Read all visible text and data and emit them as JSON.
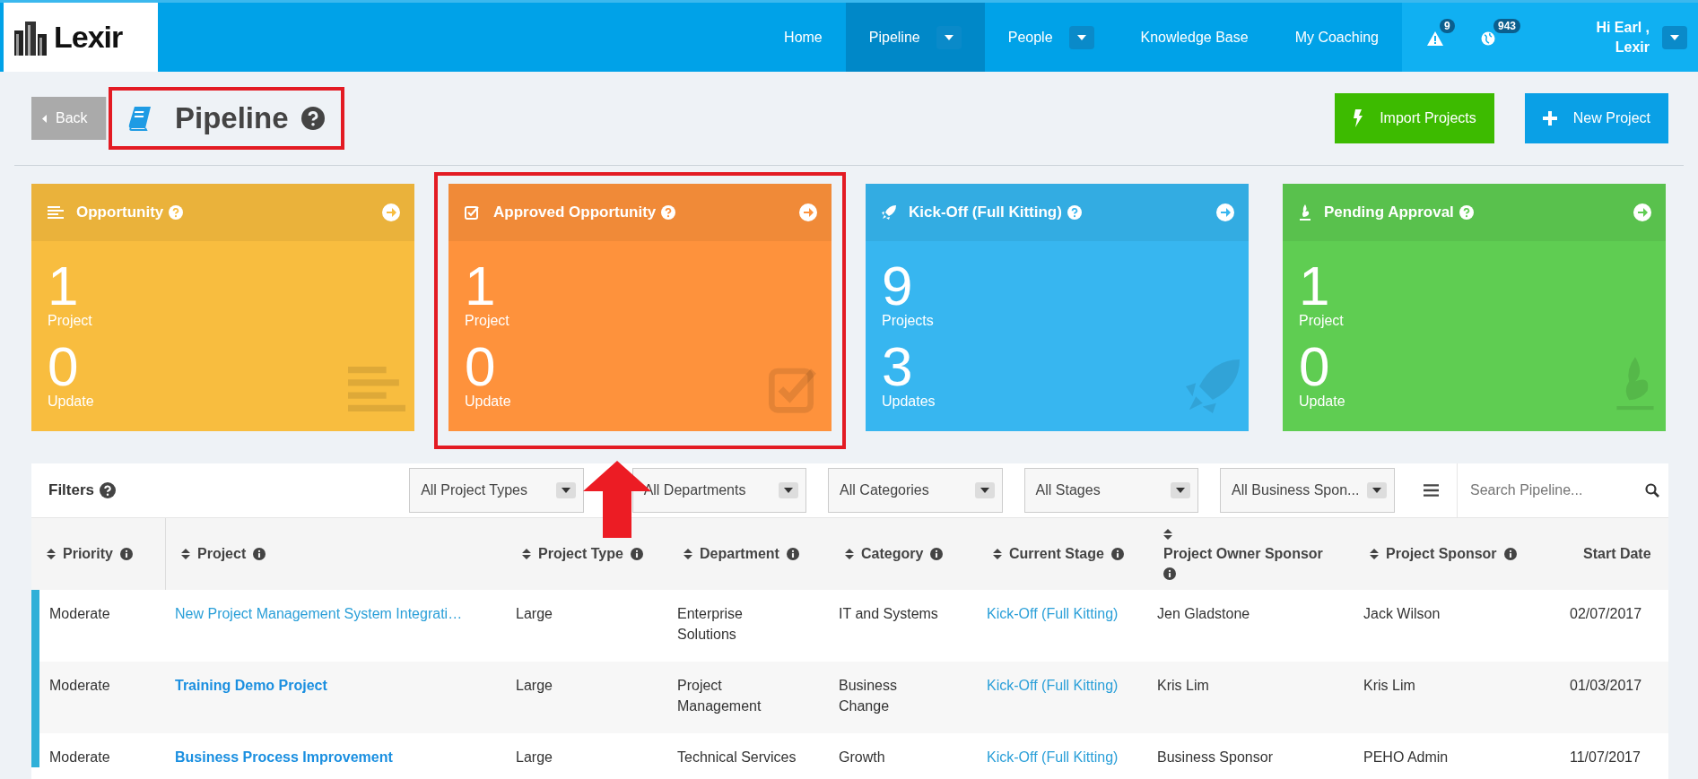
{
  "header": {
    "logo": "Lexir",
    "nav": [
      {
        "label": "Home",
        "selected": false,
        "has_menu": false
      },
      {
        "label": "Pipeline",
        "selected": true,
        "has_menu": true
      },
      {
        "label": "People",
        "selected": false,
        "has_menu": true
      },
      {
        "label": "Knowledge Base",
        "selected": false,
        "has_menu": false
      },
      {
        "label": "My Coaching",
        "selected": false,
        "has_menu": false
      }
    ],
    "notifications": [
      {
        "kind": "alert",
        "count": "9"
      },
      {
        "kind": "globe",
        "count": "943"
      }
    ],
    "user": {
      "greeting": "Hi Earl ,",
      "org": "Lexir"
    }
  },
  "page": {
    "back": "Back",
    "title": "Pipeline",
    "title_highlighted": true,
    "actions": [
      {
        "kind": "import",
        "label": "Import Projects"
      },
      {
        "kind": "new",
        "label": "New Project"
      }
    ]
  },
  "cards": [
    {
      "kind": "list",
      "title": "Opportunity",
      "color": "#f8bd3f",
      "count": "1",
      "count_label": "Project",
      "updates": "0",
      "updates_label": "Update",
      "highlighted": false
    },
    {
      "kind": "check",
      "title": "Approved Opportunity",
      "color": "#fe923c",
      "count": "1",
      "count_label": "Project",
      "updates": "0",
      "updates_label": "Update",
      "highlighted": true
    },
    {
      "kind": "rocket",
      "title": "Kick-Off (Full Kitting)",
      "color": "#37b6f0",
      "count": "9",
      "count_label": "Projects",
      "updates": "3",
      "updates_label": "Updates",
      "highlighted": false
    },
    {
      "kind": "fire",
      "title": "Pending Approval",
      "color": "#5fcd52",
      "count": "1",
      "count_label": "Project",
      "updates": "0",
      "updates_label": "Update",
      "highlighted": false
    }
  ],
  "filters": {
    "label": "Filters",
    "dropdowns": [
      "All Project Types",
      "All Departments",
      "All Categories",
      "All Stages",
      "All Business Spon..."
    ],
    "search_placeholder": "Search Pipeline..."
  },
  "table": {
    "columns": [
      "Priority",
      "Project",
      "Project Type",
      "Department",
      "Category",
      "Current Stage",
      "Project Owner Sponsor",
      "Project Sponsor",
      "Start Date"
    ],
    "rows": [
      {
        "priority": "Moderate",
        "project": "New Project Management System Integrati…",
        "project_bold": false,
        "project_type": "Large",
        "department": "Enterprise Solutions",
        "category": "IT and Systems",
        "stage": "Kick-Off (Full Kitting)",
        "owner_sponsor": "Jen Gladstone",
        "sponsor": "Jack Wilson",
        "start_date": "02/07/2017"
      },
      {
        "priority": "Moderate",
        "project": "Training Demo Project",
        "project_bold": true,
        "project_type": "Large",
        "department": "Project Management",
        "category": "Business Change",
        "stage": "Kick-Off (Full Kitting)",
        "owner_sponsor": "Kris Lim",
        "sponsor": "Kris Lim",
        "start_date": "01/03/2017"
      },
      {
        "priority": "Moderate",
        "project": "Business Process Improvement",
        "project_bold": true,
        "project_type": "Large",
        "department": "Technical Services",
        "category": "Growth",
        "stage": "Kick-Off (Full Kitting)",
        "owner_sponsor": "Business Sponsor",
        "sponsor": "PEHO Admin",
        "start_date": "11/07/2017"
      }
    ]
  }
}
